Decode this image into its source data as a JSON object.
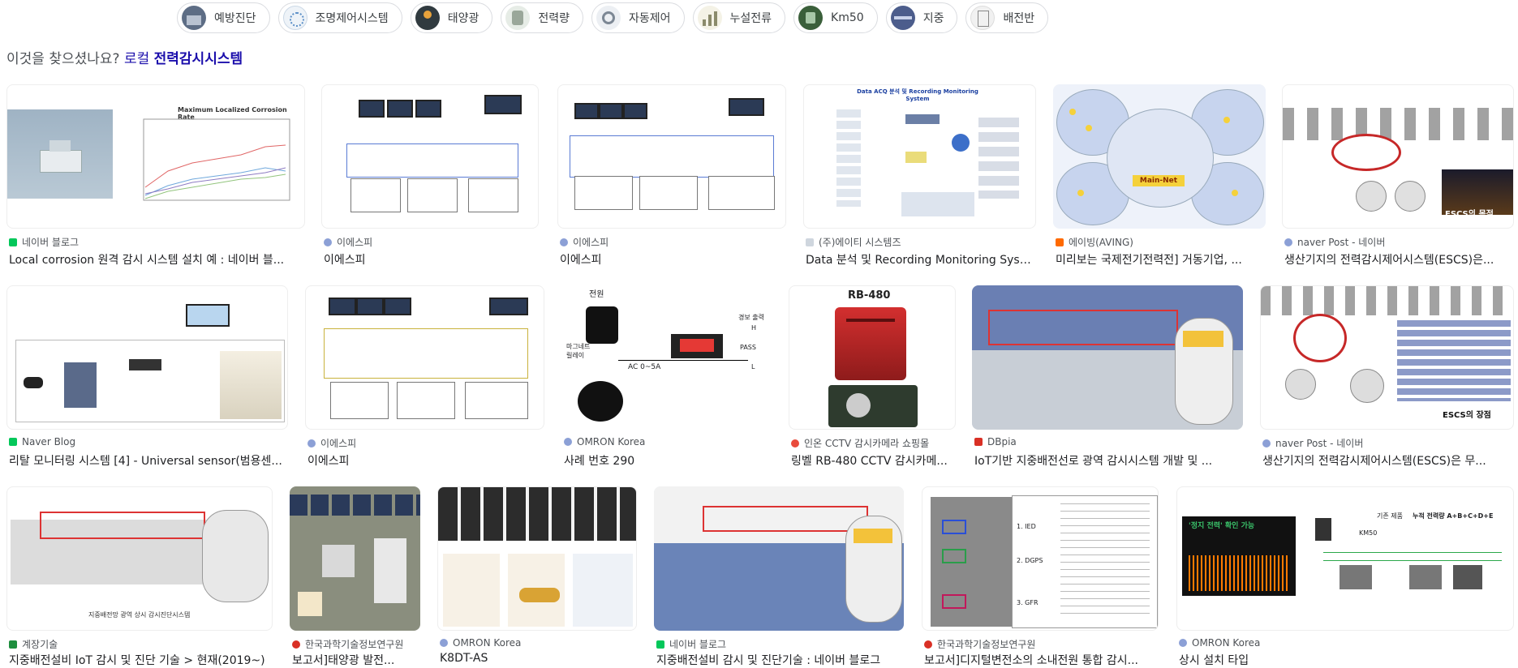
{
  "chips": [
    {
      "label": "예방진단",
      "icon": "building-icon",
      "color": "#5d6d85"
    },
    {
      "label": "조명제어시스템",
      "icon": "network-icon",
      "color": "#9ab7d3"
    },
    {
      "label": "태양광",
      "icon": "solar-icon",
      "color": "#303a3f"
    },
    {
      "label": "전력량",
      "icon": "meter-icon",
      "color": "#c9d5c9"
    },
    {
      "label": "자동제어",
      "icon": "gear-icon",
      "color": "#d7dbe2"
    },
    {
      "label": "누설전류",
      "icon": "chart-icon",
      "color": "#e9e7d8"
    },
    {
      "label": "Km50",
      "icon": "device-icon",
      "color": "#3a5f3a"
    },
    {
      "label": "지중",
      "icon": "cable-icon",
      "color": "#4c5d8c"
    },
    {
      "label": "배전반",
      "icon": "panel-icon",
      "color": "#e4e4e4"
    }
  ],
  "did_you_mean": {
    "prefix": "이것을 찾으셨나요? ",
    "link_plain": "로컬 ",
    "link_bold": "전력감시시스템"
  },
  "results": [
    {
      "source": "네이버 블로그",
      "title": "Local corrosion 원격 감시 시스템 설치 예 : 네이버 블...",
      "favicon": "#03c75a",
      "chart_title": "Maximum Localized Corrosion Rate"
    },
    {
      "source": "이에스피",
      "title": "이에스피",
      "favicon": "#8ca0d6"
    },
    {
      "source": "이에스피",
      "title": "이에스피",
      "favicon": "#8ca0d6"
    },
    {
      "source": "(주)에이티 시스템즈",
      "title": "Data 분석 및 Recording Monitoring Syste...",
      "favicon": "#cfd6de",
      "chart_title": "Data ACQ 분석 및 Recording Monitoring System"
    },
    {
      "source": "에이빙(AVING)",
      "title": "미리보는 국제전기전력전] 거동기업, ...",
      "favicon": "#ff6a00",
      "center_label": "Main-Net"
    },
    {
      "source": "naver Post - 네이버",
      "title": "생산기지의 전력감시제어시스템(ESCS)은...",
      "favicon": "#8ca0d6",
      "caption": "ESCS의 목적"
    },
    {
      "source": "Naver Blog",
      "title": "리탈 모니터링 시스템 [4] - Universal sensor(범용센...",
      "favicon": "#03c75a"
    },
    {
      "source": "이에스피",
      "title": "이에스피",
      "favicon": "#8ca0d6"
    },
    {
      "source": "OMRON Korea",
      "title": "사례 번호 290",
      "favicon": "#8ca0d6",
      "labels": [
        "전원",
        "경보 출력",
        "PASS",
        "AC 0~5A",
        "마그네트 릴레이",
        "H",
        "L"
      ]
    },
    {
      "source": "인온 CCTV 감시카메라 쇼핑몰",
      "title": "링벨 RB-480 CCTV 감시카메...",
      "favicon": "#e94b3c",
      "caption": "RB-480"
    },
    {
      "source": "DBpia",
      "title": "IoT기반 지중배전선로 광역 감시시스템 개발 및 ...",
      "favicon": "#d93025"
    },
    {
      "source": "naver Post - 네이버",
      "title": "생산기지의 전력감시제어시스템(ESCS)은 무...",
      "favicon": "#8ca0d6",
      "caption": "ESCS의 장점"
    },
    {
      "source": "계장기술",
      "title": "지중배전설비 IoT 감시 및 진단 기술 > 현재(2019~)",
      "favicon": "#1e8e3e",
      "caption": "지중배전망 광역 상시 감시진단시스템"
    },
    {
      "source": "한국과학기술정보연구원",
      "title": "보고서]태양광 발전...",
      "favicon": "#d93025"
    },
    {
      "source": "OMRON Korea",
      "title": "K8DT-AS",
      "favicon": "#8ca0d6"
    },
    {
      "source": "네이버 블로그",
      "title": "지중배전설비 감시 및 진단기술 : 네이버 블로그",
      "favicon": "#03c75a"
    },
    {
      "source": "한국과학기술정보연구원",
      "title": "보고서]디지털변전소의 소내전원 통합 감시...",
      "favicon": "#d93025",
      "labels": [
        "1. IED",
        "2. DGPS",
        "3. GFR"
      ]
    },
    {
      "source": "OMRON Korea",
      "title": "상시 설치 타입",
      "favicon": "#8ca0d6",
      "labels": [
        "'정지 전력' 확인 가능",
        "기존 제품",
        "누적 전력량 A+B+C+D+E",
        "KM50"
      ]
    }
  ]
}
